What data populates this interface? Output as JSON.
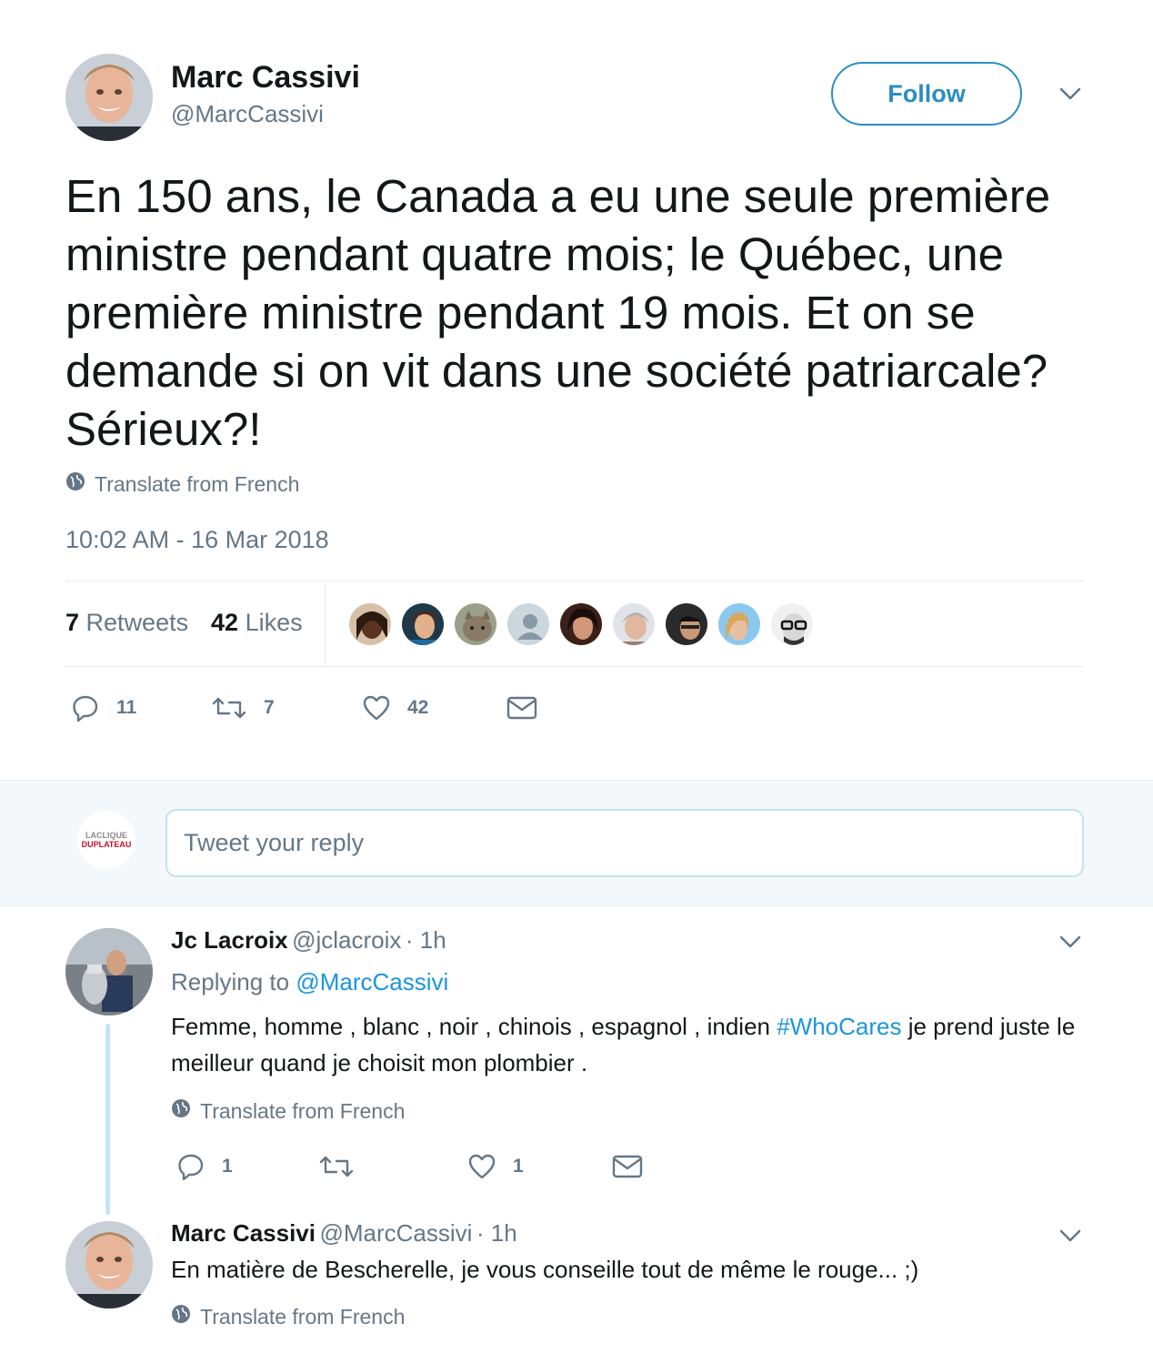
{
  "main_tweet": {
    "author_name": "Marc Cassivi",
    "author_handle": "@MarcCassivi",
    "follow_label": "Follow",
    "text": "En 150 ans, le Canada a eu une seule première ministre pendant quatre mois; le Québec, une première ministre pendant 19 mois. Et on se demande si on vit dans une société patriarcale? Sérieux?!",
    "translate_label": "Translate from French",
    "timestamp": "10:02 AM - 16 Mar 2018",
    "retweets_count": "7",
    "retweets_label": "Retweets",
    "likes_count": "42",
    "likes_label": "Likes",
    "actions": {
      "reply_count": "11",
      "retweet_count": "7",
      "like_count": "42"
    }
  },
  "reply_box": {
    "placeholder": "Tweet your reply",
    "avatar_line1": "LACLIQUE",
    "avatar_line2": "DUPLATEAU"
  },
  "replies": [
    {
      "author_name": "Jc Lacroix",
      "author_handle": "@jclacroix",
      "time": "· 1h",
      "replying_prefix": "Replying to",
      "replying_to": "@MarcCassivi",
      "text_before": "Femme, homme , blanc , noir , chinois , espagnol , indien ",
      "hashtag": "#WhoCares",
      "text_after": " je prend juste le meilleur quand je choisit mon plombier .",
      "translate_label": "Translate from French",
      "reply_count": "1",
      "retweet_count": "",
      "like_count": "1"
    },
    {
      "author_name": "Marc Cassivi",
      "author_handle": "@MarcCassivi",
      "time": "· 1h",
      "text": "En matière de Bescherelle, je vous conseille tout de même le rouge... ;)",
      "translate_label": "Translate from French"
    }
  ],
  "colors": {
    "accent": "#1da1f2",
    "link": "#1b95e0",
    "secondary_text": "#657786",
    "border": "#e6ecf0"
  }
}
